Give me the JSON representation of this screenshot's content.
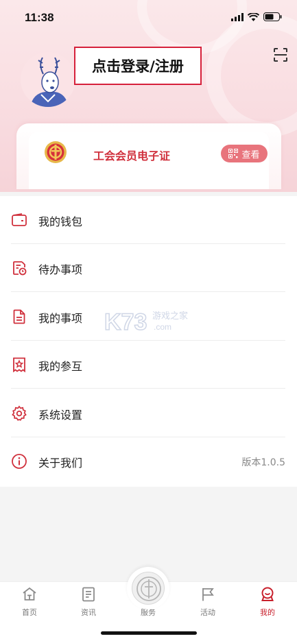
{
  "status_bar": {
    "time": "11:38"
  },
  "header": {
    "login_text": "点击登录/注册",
    "avatar_icon": "deer-avatar-icon",
    "scan_icon": "scan-icon"
  },
  "card": {
    "title": "工会会员电子证",
    "view_label": "查看",
    "logo_icon": "union-emblem-icon"
  },
  "menu": [
    {
      "label": "我的钱包",
      "icon": "wallet-icon",
      "right": ""
    },
    {
      "label": "待办事项",
      "icon": "todo-clock-icon",
      "right": ""
    },
    {
      "label": "我的事项",
      "icon": "document-icon",
      "right": ""
    },
    {
      "label": "我的参互",
      "icon": "star-badge-icon",
      "right": ""
    },
    {
      "label": "系统设置",
      "icon": "gear-icon",
      "right": ""
    },
    {
      "label": "关于我们",
      "icon": "info-icon",
      "right": "版本1.0.5"
    }
  ],
  "watermark": {
    "text": "游戏之家",
    "sub": ".com",
    "logo": "K73"
  },
  "tabbar": [
    {
      "label": "首页",
      "icon": "home-icon",
      "active": false
    },
    {
      "label": "资讯",
      "icon": "news-icon",
      "active": false
    },
    {
      "label": "服务",
      "icon": "service-emblem-icon",
      "active": false
    },
    {
      "label": "活动",
      "icon": "flag-icon",
      "active": false
    },
    {
      "label": "我的",
      "icon": "profile-icon",
      "active": true
    }
  ],
  "colors": {
    "accent": "#c8202c",
    "icon_red": "#d0303c",
    "view_button": "#e8747c"
  }
}
